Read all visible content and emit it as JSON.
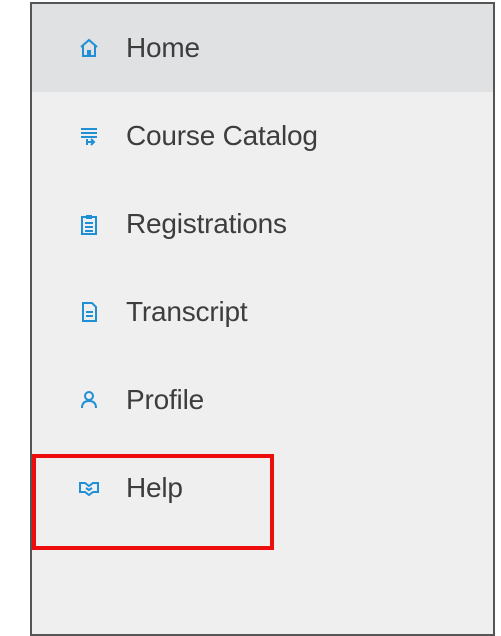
{
  "menu": {
    "items": [
      {
        "label": "Home",
        "icon": "home-icon",
        "active": true
      },
      {
        "label": "Course Catalog",
        "icon": "catalog-icon",
        "active": false
      },
      {
        "label": "Registrations",
        "icon": "clipboard-icon",
        "active": false
      },
      {
        "label": "Transcript",
        "icon": "document-icon",
        "active": false
      },
      {
        "label": "Profile",
        "icon": "user-icon",
        "active": false
      },
      {
        "label": "Help",
        "icon": "handshake-icon",
        "active": false
      }
    ]
  },
  "colors": {
    "icon": "#1f8fd6",
    "text": "#3d3d3d",
    "active_bg": "#dfe1e3",
    "panel_bg": "#efefef",
    "highlight": "#ee0d0d"
  },
  "annotation": {
    "highlighted_item": "Help"
  }
}
